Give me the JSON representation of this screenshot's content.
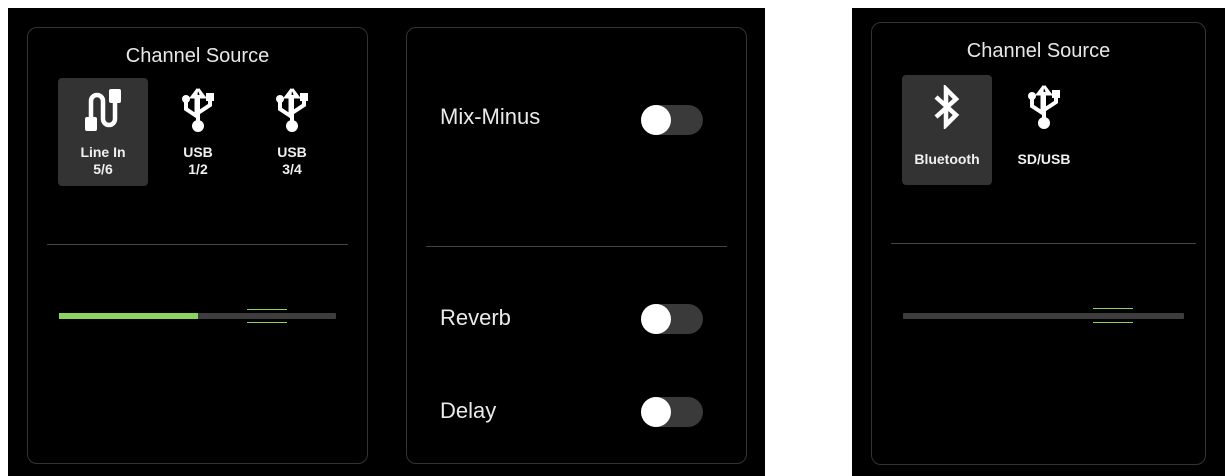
{
  "left_panel": {
    "title": "Channel Source",
    "sources": [
      {
        "label_line1": "Line In",
        "label_line2": "5/6",
        "icon": "line-in-icon",
        "selected": true
      },
      {
        "label_line1": "USB",
        "label_line2": "1/2",
        "icon": "usb-icon",
        "selected": false
      },
      {
        "label_line1": "USB",
        "label_line2": "3/4",
        "icon": "usb-icon",
        "selected": false
      }
    ],
    "level_fraction": 0.5
  },
  "fx_panel": {
    "mix_minus": {
      "label": "Mix-Minus",
      "on": false
    },
    "reverb": {
      "label": "Reverb",
      "on": false
    },
    "delay": {
      "label": "Delay",
      "on": false
    }
  },
  "right_panel": {
    "title": "Channel Source",
    "sources": [
      {
        "label": "Bluetooth",
        "icon": "bluetooth-icon",
        "selected": true
      },
      {
        "label": "SD/USB",
        "icon": "usb-icon",
        "selected": false
      }
    ],
    "level_fraction": 0
  },
  "colors": {
    "accent": "#8ed35f",
    "background": "#000000",
    "selected_bg": "#333333"
  }
}
